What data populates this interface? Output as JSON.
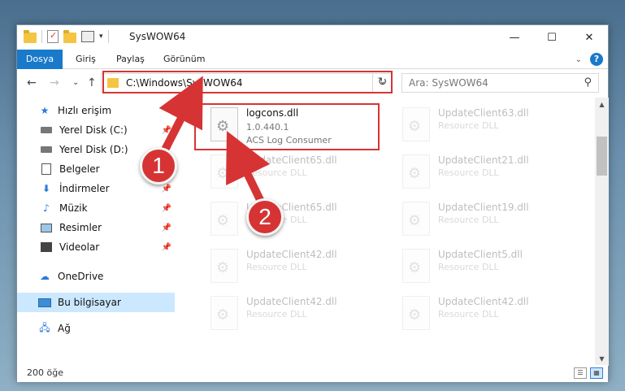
{
  "window": {
    "title": "SysWOW64",
    "minimize_glyph": "—",
    "maximize_glyph": "☐",
    "close_glyph": "✕"
  },
  "ribbon": {
    "tabs": [
      "Dosya",
      "Giriş",
      "Paylaş",
      "Görünüm"
    ],
    "help_glyph": "?",
    "expand_glyph": "⌄"
  },
  "address": {
    "path": "C:\\Windows\\SysWOW64",
    "search_placeholder": "Ara: SysWOW64",
    "back_glyph": "←",
    "forward_glyph": "→",
    "recent_glyph": "⌄",
    "up_glyph": "↑",
    "refresh_glyph": "↻",
    "search_glyph": "⚲"
  },
  "nav": {
    "quick_access": "Hızlı erişim",
    "items": [
      {
        "label": "Yerel Disk (C:)",
        "icon": "drive-icon",
        "pinned": true
      },
      {
        "label": "Yerel Disk (D:)",
        "icon": "drive-icon",
        "pinned": true
      },
      {
        "label": "Belgeler",
        "icon": "documents-icon",
        "pinned": true
      },
      {
        "label": "İndirmeler",
        "icon": "download-icon",
        "pinned": true
      },
      {
        "label": "Müzik",
        "icon": "music-icon",
        "pinned": true
      },
      {
        "label": "Resimler",
        "icon": "pictures-icon",
        "pinned": true
      },
      {
        "label": "Videolar",
        "icon": "videos-icon",
        "pinned": true
      }
    ],
    "onedrive": "OneDrive",
    "this_pc": "Bu bilgisayar",
    "network": "Ağ"
  },
  "files": [
    {
      "name": "logcons.dll",
      "version": "1.0.440.1",
      "description": "ACS Log Consumer",
      "highlighted": true
    },
    {
      "name": "UpdateClient63.dll",
      "version": "",
      "description": "Resource DLL"
    },
    {
      "name": "UpdateClient65.dll",
      "version": "",
      "description": "Resource DLL"
    },
    {
      "name": "UpdateClient21.dll",
      "version": "",
      "description": "Resource DLL"
    },
    {
      "name": "UpdateClient65.dll",
      "version": "",
      "description": "Resource DLL"
    },
    {
      "name": "UpdateClient19.dll",
      "version": "",
      "description": "Resource DLL"
    },
    {
      "name": "UpdateClient42.dll",
      "version": "",
      "description": "Resource DLL"
    },
    {
      "name": "UpdateClient5.dll",
      "version": "",
      "description": "Resource DLL"
    },
    {
      "name": "UpdateClient42.dll",
      "version": "",
      "description": "Resource DLL"
    },
    {
      "name": "UpdateClient42.dll",
      "version": "",
      "description": "Resource DLL"
    }
  ],
  "status": {
    "count": "200 öğe"
  },
  "annotations": {
    "badge1": "1",
    "badge2": "2",
    "color": "#d63434"
  }
}
